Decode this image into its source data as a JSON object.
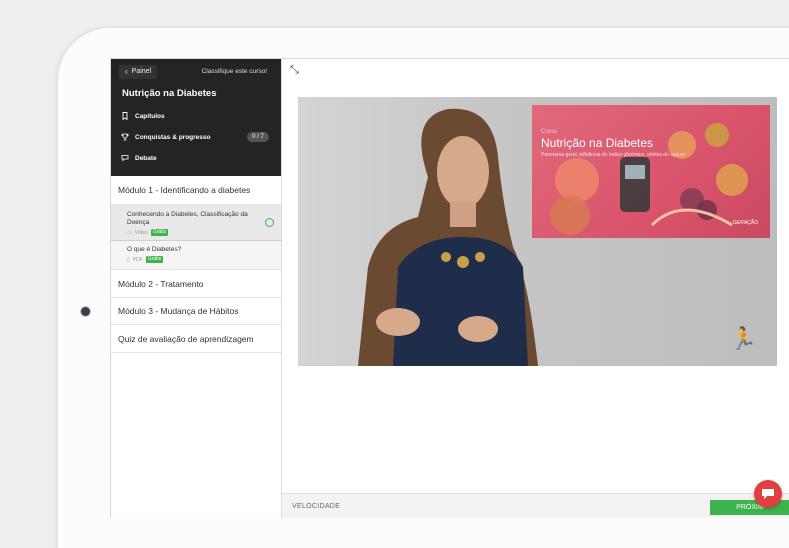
{
  "sidebar": {
    "back_label": "Painel",
    "rate_label": "Classifique este curso!",
    "course_title": "Nutrição na Diabetes",
    "menu": {
      "chapters": "Capítulos",
      "achievements": "Conquistas & progresso",
      "achievements_badge": "0 / 7",
      "debate": "Debate"
    },
    "module1": "Módulo 1 - Identificando a diabetes",
    "lessons": [
      {
        "title": "Conhecendo a Diabetes, Classificação da Doença",
        "type": "Vídeo",
        "tag": "Grátis"
      },
      {
        "title": "O que é Diabetes?",
        "type": "PDF",
        "tag": "Grátis"
      }
    ],
    "module2": "Módulo 2 - Tratamento",
    "module3": "Módulo 3 - Mudança de Hábitos",
    "quiz": "Quiz de avaliação de aprendizagem"
  },
  "video": {
    "slide_small": "Curso",
    "slide_title": "Nutrição na Diabetes",
    "slide_subtitle": "Panorama geral, influência do índice glicêmico, efeitos do açúcar",
    "slide_brand": "GERAÇÃO"
  },
  "bottom": {
    "speed_label": "VELOCIDADE",
    "next_label": "PRÓXIM"
  },
  "colors": {
    "accent": "#3cb44b",
    "sidebar_dark": "#242424",
    "chat": "#e04040"
  },
  "icons": [
    "chevron-left-icon",
    "bookmark-icon",
    "trophy-icon",
    "chat-bubble-icon",
    "expand-icon",
    "video-icon",
    "pdf-icon",
    "check-circle-icon",
    "chat-icon"
  ]
}
